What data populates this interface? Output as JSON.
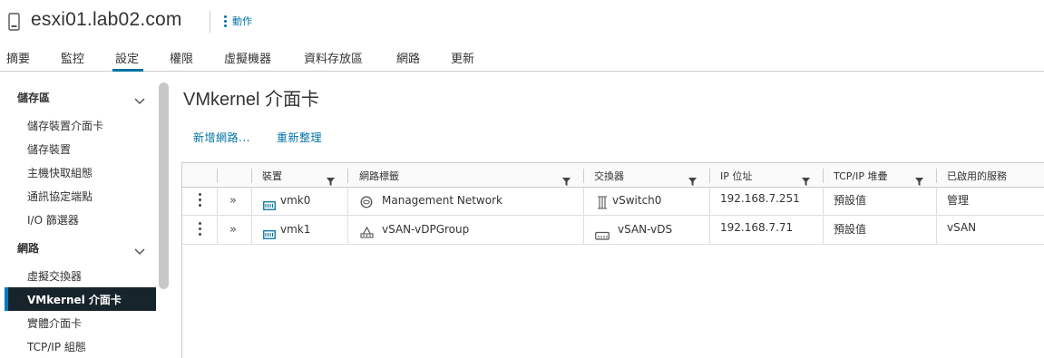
{
  "header": {
    "host_name": "esxi01.lab02.com",
    "actions_label": "動作"
  },
  "tabs": [
    {
      "label": "摘要"
    },
    {
      "label": "監控"
    },
    {
      "label": "設定",
      "active": true
    },
    {
      "label": "權限"
    },
    {
      "label": "虛擬機器"
    },
    {
      "label": "資料存放區"
    },
    {
      "label": "網路"
    },
    {
      "label": "更新"
    }
  ],
  "sidebar": {
    "groups": [
      {
        "label": "儲存區",
        "items": [
          "儲存裝置介面卡",
          "儲存裝置",
          "主機快取組態",
          "通訊協定端點",
          "I/O 篩選器"
        ]
      },
      {
        "label": "網路",
        "items": [
          "虛擬交換器",
          "VMkernel 介面卡",
          "實體介面卡",
          "TCP/IP 組態"
        ]
      }
    ],
    "selected": "VMkernel 介面卡"
  },
  "main": {
    "title": "VMkernel 介面卡",
    "add_network_label": "新增網路...",
    "refresh_label": "重新整理"
  },
  "table": {
    "columns": [
      "裝置",
      "網路標籤",
      "交換器",
      "IP 位址",
      "TCP/IP 堆疊",
      "已啟用的服務"
    ],
    "rows": [
      {
        "device": "vmk0",
        "network_label": "Management Network",
        "switch": "vSwitch0",
        "ip": "192.168.7.251",
        "tcpip_stack": "預設值",
        "services": "管理"
      },
      {
        "device": "vmk1",
        "network_label": "vSAN-vDPGroup",
        "switch": "vSAN-vDS",
        "ip": "192.168.7.71",
        "tcpip_stack": "預設值",
        "services": "vSAN"
      }
    ]
  },
  "colors": {
    "accent": "#0072a3",
    "selected_bg": "#17242b",
    "selected_border": "#0079b8"
  },
  "icons": {
    "host": "host-icon",
    "actions": "vertical-dots-icon",
    "chevron": "chevron-down-icon",
    "filter": "filter-icon",
    "vmk_nic": "network-adapter-icon",
    "port_group": "standard-portgroup-icon",
    "distributed_port_group": "distributed-portgroup-icon",
    "standard_switch": "standard-switch-icon",
    "distributed_switch": "distributed-switch-icon",
    "row_menu": "row-actions-icon",
    "expand": "expand-row-icon"
  }
}
